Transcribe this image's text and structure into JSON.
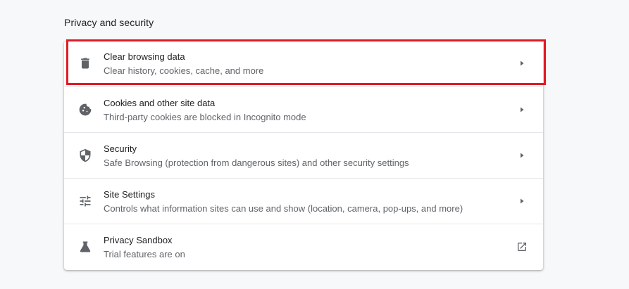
{
  "section": {
    "title": "Privacy and security"
  },
  "rows": [
    {
      "label": "Clear browsing data",
      "sublabel": "Clear history, cookies, cache, and more",
      "icon": "trash-icon",
      "end_icon": "chevron-right-icon"
    },
    {
      "label": "Cookies and other site data",
      "sublabel": "Third-party cookies are blocked in Incognito mode",
      "icon": "cookie-icon",
      "end_icon": "chevron-right-icon"
    },
    {
      "label": "Security",
      "sublabel": "Safe Browsing (protection from dangerous sites) and other security settings",
      "icon": "shield-icon",
      "end_icon": "chevron-right-icon"
    },
    {
      "label": "Site Settings",
      "sublabel": "Controls what information sites can use and show (location, camera, pop-ups, and more)",
      "icon": "tune-sliders-icon",
      "end_icon": "chevron-right-icon"
    },
    {
      "label": "Privacy Sandbox",
      "sublabel": "Trial features are on",
      "icon": "flask-icon",
      "end_icon": "open-in-new-icon"
    }
  ],
  "highlight": {
    "target": "Clear browsing data",
    "color": "#e01b24"
  },
  "colors": {
    "background": "#f7f8fa",
    "card": "#ffffff",
    "icon": "#5f6368",
    "primary_text": "#202124",
    "secondary_text": "#5f6368"
  }
}
